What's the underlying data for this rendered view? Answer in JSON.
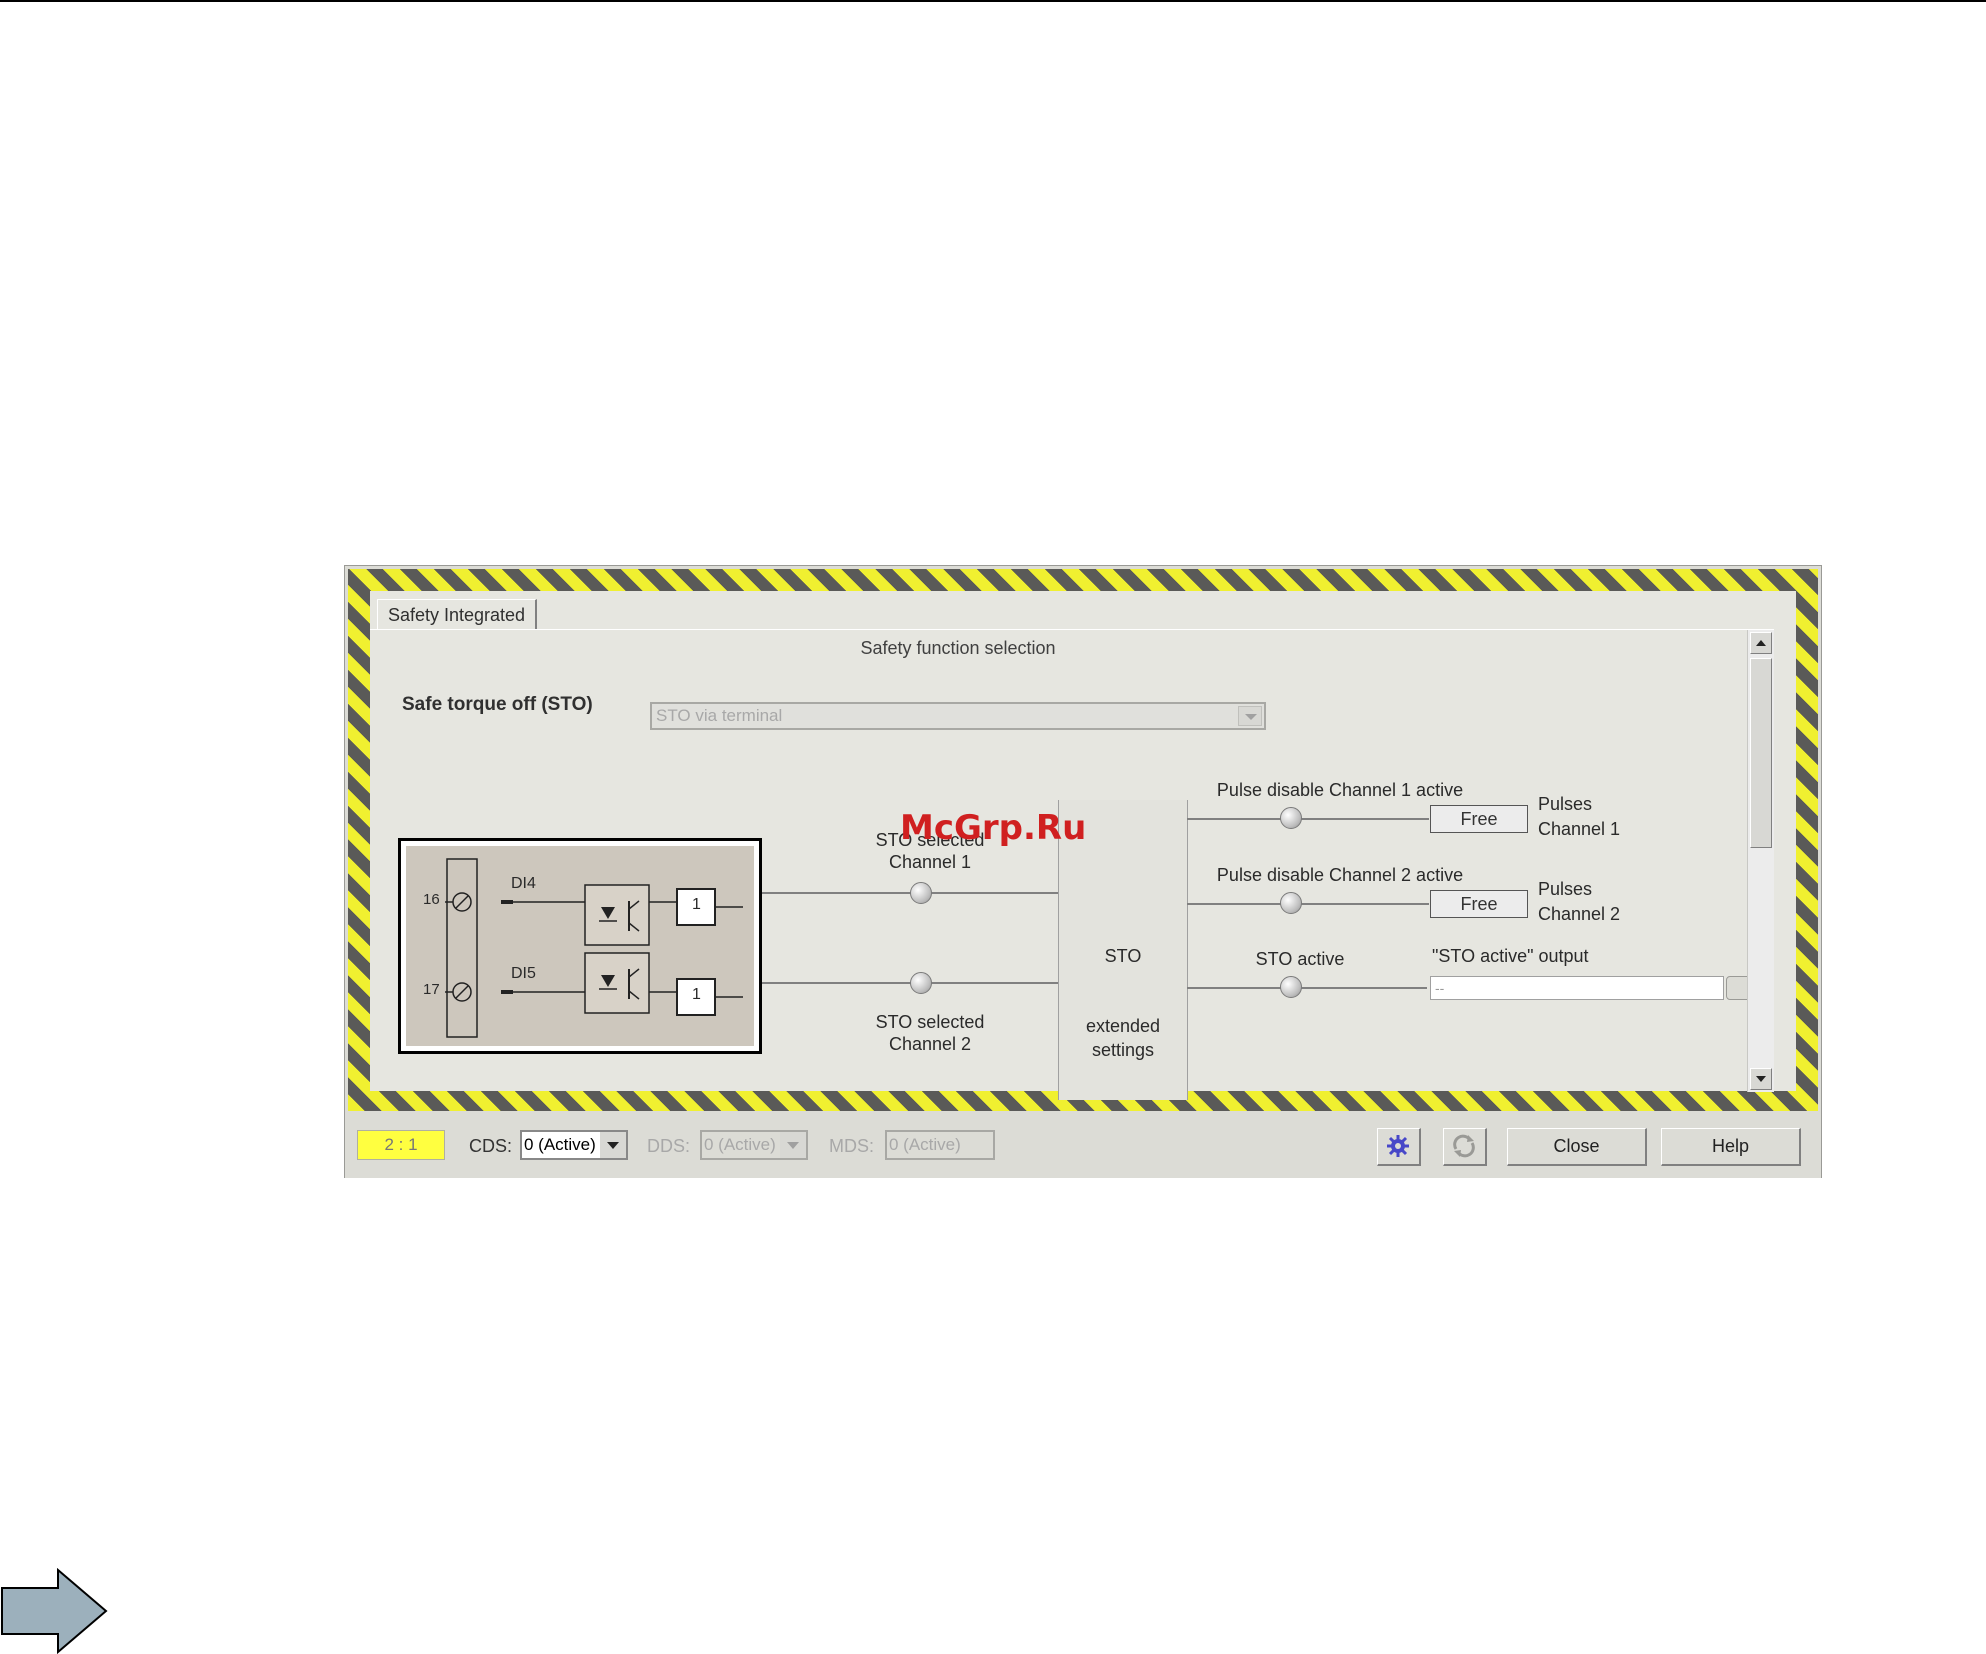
{
  "tab": {
    "label": "Safety Integrated"
  },
  "selection": {
    "heading": "Safety function selection",
    "value": "STO via terminal"
  },
  "section_title": "Safe torque off (STO)",
  "schematic": {
    "terminal_top": "16",
    "terminal_bottom": "17",
    "input_top": "DI4",
    "input_bottom": "DI5",
    "gate_label": "1"
  },
  "signals": {
    "sto_sel_ch1": [
      "STO selected",
      "Channel 1"
    ],
    "sto_sel_ch2": [
      "STO selected",
      "Channel 2"
    ],
    "sto_box": {
      "title": "STO",
      "ext1": "extended",
      "ext2": "settings"
    },
    "pulse_ch1_label": "Pulse disable Channel 1 active",
    "pulse_ch2_label": "Pulse disable Channel 2 active",
    "free_ch1": "Free",
    "free_ch2": "Free",
    "pulses_ch1": [
      "Pulses",
      "Channel 1"
    ],
    "pulses_ch2": [
      "Pulses",
      "Channel 2"
    ],
    "sto_active": "STO active",
    "sto_output_label": "\"STO active\" output",
    "sto_output_value": "--"
  },
  "bottom": {
    "ratio": "2 : 1",
    "cds_label": "CDS:",
    "cds_value": "0 (Active)",
    "dds_label": "DDS:",
    "dds_value": "0 (Active)",
    "mds_label": "MDS:",
    "mds_value": "0 (Active)",
    "close": "Close",
    "help": "Help"
  },
  "watermark": "McGrp.Ru",
  "icons": [
    "gear-icon",
    "refresh-icon",
    "scroll-up-icon",
    "scroll-down-icon",
    "next-arrow-icon"
  ]
}
